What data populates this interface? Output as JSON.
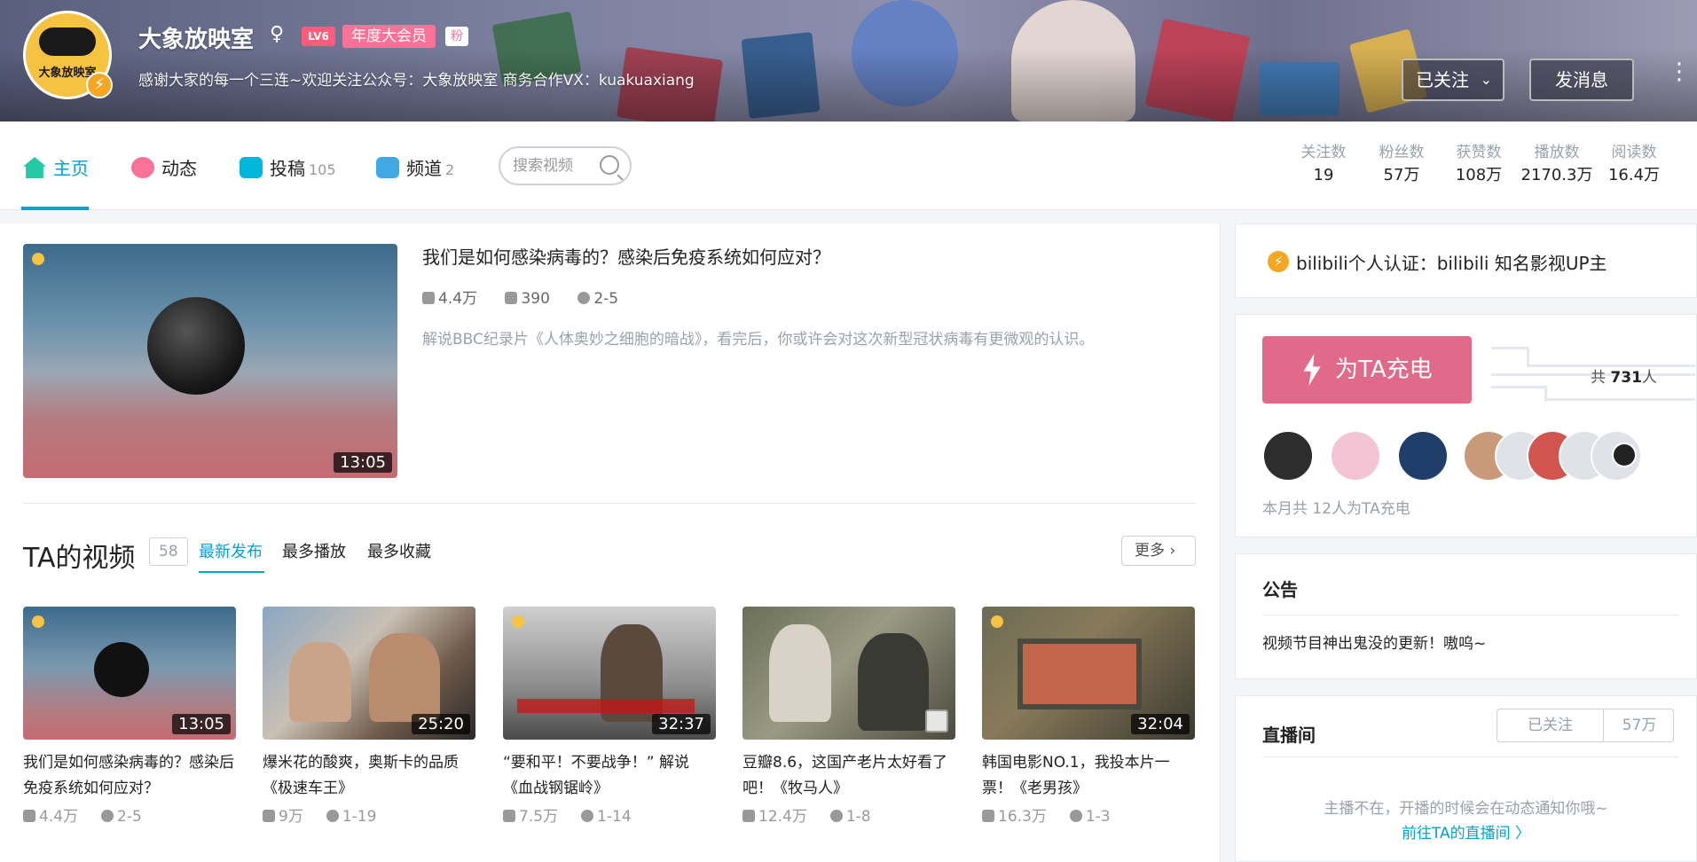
{
  "header": {
    "avatar_text": "大象放映室",
    "username": "大象放映室",
    "gender_icon": "female-icon",
    "level": "LV6",
    "vip_badge": "年度大会员",
    "fan_badge": "粉",
    "signature": "感谢大家的每一个三连~欢迎关注公众号：大象放映室 商务合作VX：kuakuaxiang",
    "follow_button": "已关注",
    "message_button": "发消息",
    "more_icon": "⋮"
  },
  "nav": {
    "tabs": [
      {
        "label": "主页",
        "count": ""
      },
      {
        "label": "动态",
        "count": ""
      },
      {
        "label": "投稿",
        "count": "105"
      },
      {
        "label": "频道",
        "count": "2"
      }
    ],
    "search_placeholder": "搜索视频"
  },
  "stats": [
    {
      "key": "关注数",
      "value": "19"
    },
    {
      "key": "粉丝数",
      "value": "57万"
    },
    {
      "key": "获赞数",
      "value": "108万"
    },
    {
      "key": "播放数",
      "value": "2170.3万"
    },
    {
      "key": "阅读数",
      "value": "16.4万"
    }
  ],
  "featured": {
    "title": "我们是如何感染病毒的？感染后免疫系统如何应对？",
    "duration": "13:05",
    "plays": "4.4万",
    "danmaku": "390",
    "date": "2-5",
    "description": "解说BBC纪录片《人体奥妙之细胞的暗战》，看完后，你或许会对这次新型冠状病毒有更微观的认识。"
  },
  "videos_section": {
    "title": "TA的视频",
    "count": "58",
    "tabs": [
      "最新发布",
      "最多播放",
      "最多收藏"
    ],
    "more": "更多"
  },
  "videos": [
    {
      "title": "我们是如何感染病毒的？感染后免疫系统如何应对？",
      "duration": "13:05",
      "plays": "4.4万",
      "date": "2-5"
    },
    {
      "title": "爆米花的酸爽，奥斯卡的品质《极速车王》",
      "duration": "25:20",
      "plays": "9万",
      "date": "1-19"
    },
    {
      "title": "“要和平！不要战争！” 解说《血战钢锯岭》",
      "duration": "32:37",
      "plays": "7.5万",
      "date": "1-14"
    },
    {
      "title": "豆瓣8.6，这国产老片太好看了吧！《牧马人》",
      "duration": "",
      "plays": "12.4万",
      "date": "1-8"
    },
    {
      "title": "韩国电影NO.1，我投本片一票！《老男孩》",
      "duration": "32:04",
      "plays": "16.3万",
      "date": "1-3"
    }
  ],
  "sidebar": {
    "certification": "bilibili个人认证：bilibili 知名影视UP主",
    "charge_button": "为TA充电",
    "total_prefix": "共",
    "total_count": "731",
    "total_suffix": "人",
    "month_text": "本月共 12人为TA充电",
    "notice_title": "公告",
    "notice_body": "视频节目神出鬼没的更新！嗷呜~",
    "live_title": "直播间",
    "live_follow": "已关注",
    "live_count": "57万",
    "live_msg": "主播不在，开播的时候会在动态通知你哦~",
    "live_link": "前往TA的直播间 〉"
  },
  "colors": {
    "accent": "#00a1d6",
    "pink": "#fb7299",
    "charge": "#e16a8b"
  }
}
